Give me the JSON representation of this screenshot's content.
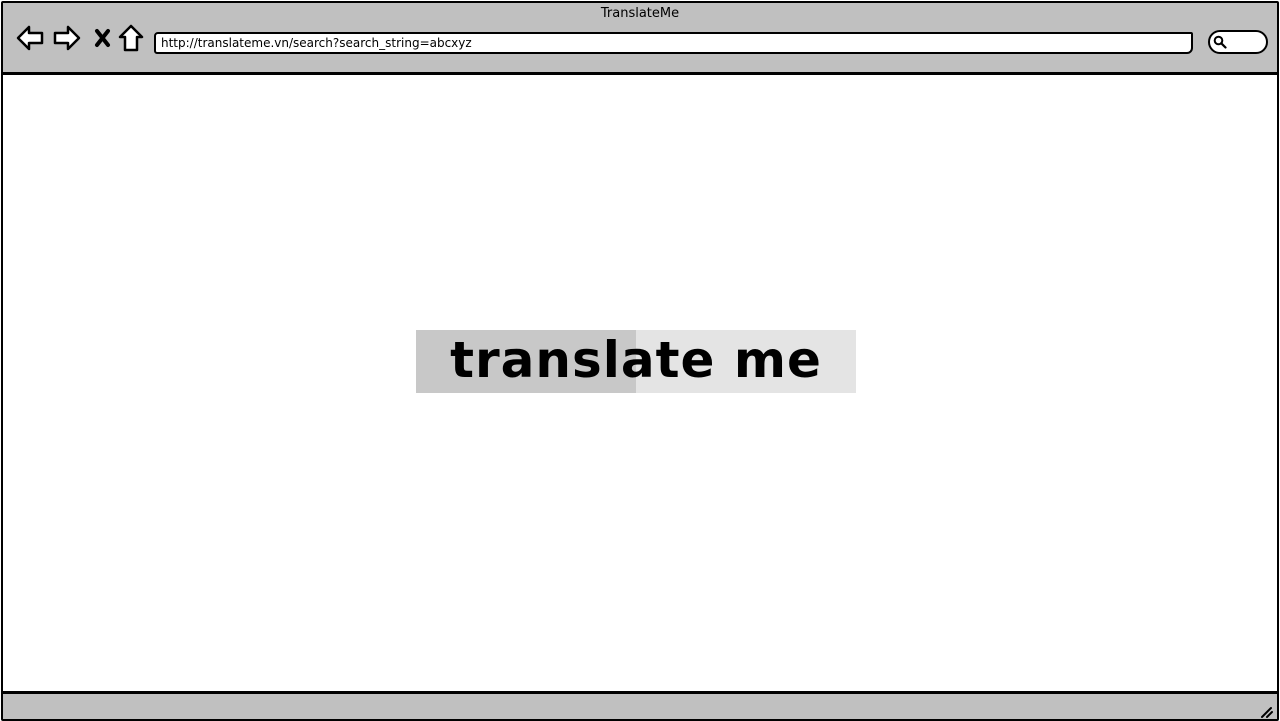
{
  "window": {
    "title": "TranslateMe"
  },
  "toolbar": {
    "icons": [
      "back-arrow-icon",
      "forward-arrow-icon",
      "stop-icon",
      "home-icon"
    ],
    "url": "http://translateme.vn/search?search_string=abcxyz",
    "search_icon": "search-icon",
    "search_value": ""
  },
  "main": {
    "logo_text": "translate me"
  },
  "colors": {
    "chrome": "#c0c0c0",
    "logo_left": "#c8c8c8",
    "logo_right": "#e4e4e4",
    "text": "#000000"
  }
}
